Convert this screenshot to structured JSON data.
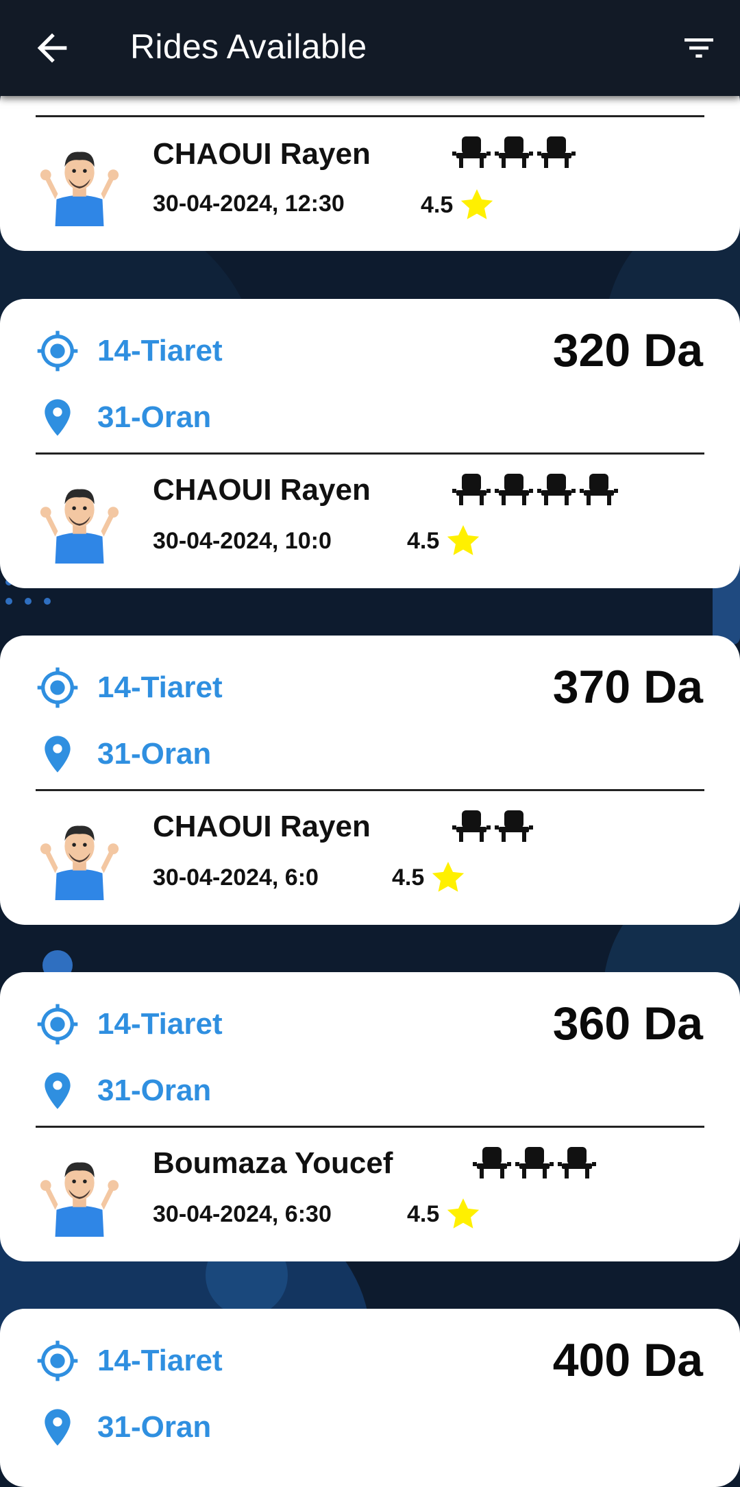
{
  "appbar": {
    "title": "Rides Available",
    "back_icon": "arrow-left-icon",
    "filter_icon": "filter-list-icon"
  },
  "colors": {
    "background": "#0d1b2e",
    "appbar": "#121a26",
    "city_text": "#2f8fe0",
    "star": "#fff000"
  },
  "rides": [
    {
      "from": "",
      "to": "",
      "price": "",
      "driver": "CHAOUI Rayen",
      "datetime": "30-04-2024, 12:30",
      "rating": "4.5",
      "seats": 3
    },
    {
      "from": "14-Tiaret",
      "to": "31-Oran",
      "price": "320 Da",
      "driver": "CHAOUI Rayen",
      "datetime": "30-04-2024, 10:0",
      "rating": "4.5",
      "seats": 4
    },
    {
      "from": "14-Tiaret",
      "to": "31-Oran",
      "price": "370 Da",
      "driver": "CHAOUI Rayen",
      "datetime": "30-04-2024, 6:0",
      "rating": "4.5",
      "seats": 2
    },
    {
      "from": "14-Tiaret",
      "to": "31-Oran",
      "price": "360 Da",
      "driver": "Boumaza Youcef",
      "datetime": "30-04-2024, 6:30",
      "rating": "4.5",
      "seats": 3
    },
    {
      "from": "14-Tiaret",
      "to": "31-Oran",
      "price": "400 Da",
      "driver": "",
      "datetime": "",
      "rating": "",
      "seats": 0
    }
  ]
}
